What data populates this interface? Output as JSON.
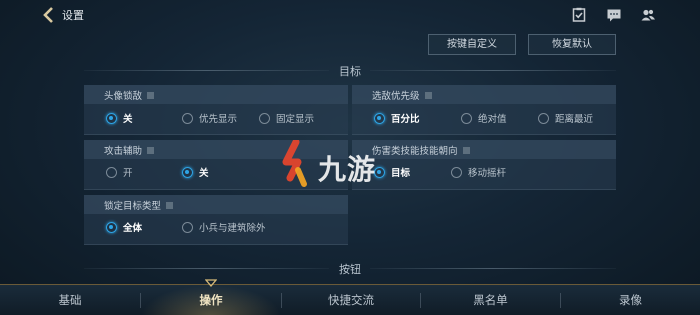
{
  "header": {
    "title": "设置",
    "icons": [
      "checklist-icon",
      "chat-icon",
      "friends-icon"
    ]
  },
  "actions": {
    "customize_keys": "按键自定义",
    "restore_default": "恢复默认"
  },
  "sections": {
    "target": "目标",
    "buttons": "按钮"
  },
  "avatar_lock": {
    "label": "头像锁敌",
    "options": [
      "关",
      "优先显示",
      "固定显示"
    ],
    "selected": "关"
  },
  "enemy_priority": {
    "label": "选敌优先级",
    "options": [
      "百分比",
      "绝对值",
      "距离最近"
    ],
    "selected": "百分比"
  },
  "attack_assist": {
    "label": "攻击辅助",
    "options": [
      "开",
      "关"
    ],
    "selected": "关"
  },
  "skill_direction": {
    "label": "伤害类技能技能朝向",
    "options": [
      "目标",
      "移动摇杆"
    ],
    "selected": "目标"
  },
  "lock_target_type": {
    "label": "锁定目标类型",
    "options": [
      "全体",
      "小兵与建筑除外"
    ],
    "selected": "全体"
  },
  "watermark": {
    "text": "九游"
  },
  "bottom_nav": {
    "tabs": [
      "基础",
      "操作",
      "快捷交流",
      "黑名单",
      "录像"
    ],
    "active": "操作"
  },
  "colors": {
    "accent": "#2ea5e6",
    "gold": "#c8aa64",
    "background": "#142535",
    "logo_red": "#e8452c",
    "logo_orange": "#f5a524"
  }
}
